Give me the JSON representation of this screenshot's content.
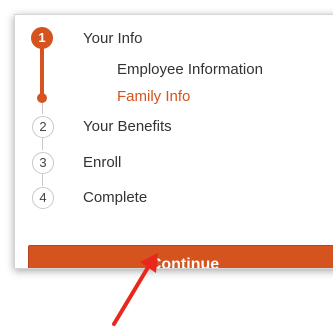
{
  "steps": [
    {
      "number": "1",
      "label": "Your Info",
      "active": true
    },
    {
      "number": "2",
      "label": "Your Benefits",
      "active": false
    },
    {
      "number": "3",
      "label": "Enroll",
      "active": false
    },
    {
      "number": "4",
      "label": "Complete",
      "active": false
    }
  ],
  "substeps": [
    {
      "label": "Employee Information",
      "current": false
    },
    {
      "label": "Family Info",
      "current": true
    }
  ],
  "continue_label": "Continue",
  "colors": {
    "accent": "#d4531f",
    "text": "#333333",
    "border": "#c9c9c9",
    "annotation_arrow": "#e8281c"
  }
}
